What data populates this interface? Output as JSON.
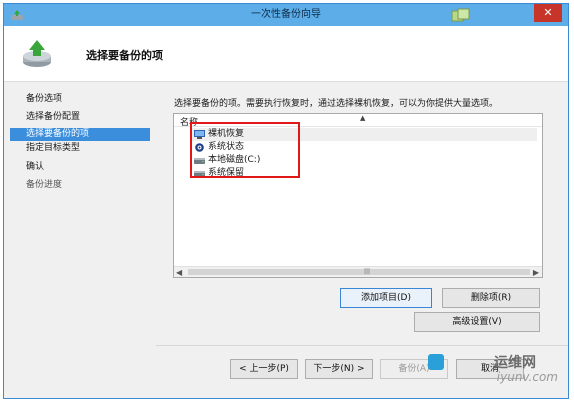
{
  "window": {
    "title": "一次性备份向导",
    "close_label": "✕"
  },
  "header": {
    "title": "选择要备份的项"
  },
  "sidebar": {
    "items": [
      {
        "label": "备份选项"
      },
      {
        "label": "选择备份配置"
      },
      {
        "label": "选择要备份的项"
      },
      {
        "label": "指定目标类型"
      },
      {
        "label": "确认"
      },
      {
        "label": "备份进度"
      }
    ]
  },
  "main": {
    "instruction": "选择要备份的项。需要执行恢复时，通过选择裸机恢复，可以为你提供大量选项。",
    "list": {
      "column_name": "名称",
      "items": [
        {
          "label": "裸机恢复",
          "icon": "bare-metal-icon"
        },
        {
          "label": "系统状态",
          "icon": "system-state-icon"
        },
        {
          "label": "本地磁盘(C:)",
          "icon": "drive-icon"
        },
        {
          "label": "系统保留",
          "icon": "drive-icon"
        }
      ]
    },
    "buttons": {
      "add_item": "添加项目(D)",
      "remove_item": "删除项(R)",
      "advanced": "高级设置(V)"
    }
  },
  "footer": {
    "prev": "< 上一步(P)",
    "next": "下一步(N) >",
    "backup": "备份(A)",
    "cancel": "取消"
  },
  "watermark": {
    "cn": "运维网",
    "url": "iyunv.com"
  },
  "colors": {
    "titlebar": "#5cade8",
    "selection": "#3b8edb",
    "highlight_box": "#e01818",
    "close": "#c7352a"
  }
}
